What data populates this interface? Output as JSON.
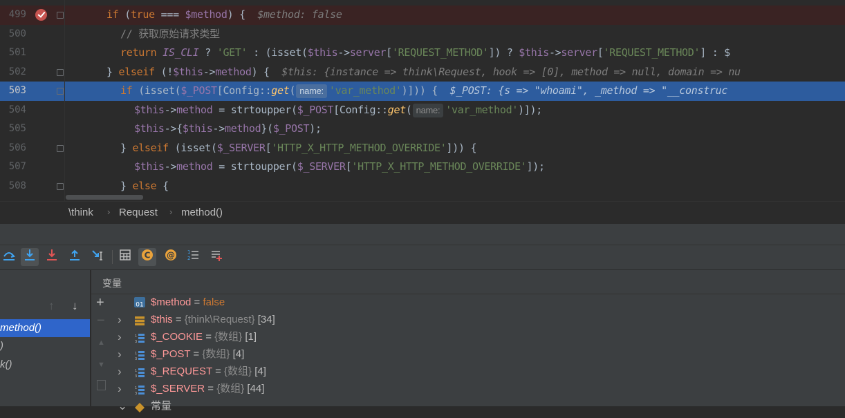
{
  "editor": {
    "lines": [
      {
        "num": "499",
        "tokens": [
          [
            "kw",
            "if"
          ],
          [
            "p",
            " ("
          ],
          [
            "kw",
            "true"
          ],
          [
            "p",
            " === "
          ],
          [
            "var",
            "$method"
          ],
          [
            "p",
            ") {"
          ]
        ],
        "hint": "$method: false",
        "indent": 3
      },
      {
        "num": "500",
        "tokens": [
          [
            "cmt",
            "// 获取原始请求类型"
          ]
        ],
        "indent": 4
      },
      {
        "num": "501",
        "tokens": [
          [
            "kw",
            "return "
          ],
          [
            "const",
            "IS_CLI"
          ],
          [
            "p",
            " ? "
          ],
          [
            "str",
            "'GET'"
          ],
          [
            "p",
            " : (isset("
          ],
          [
            "var",
            "$this"
          ],
          [
            "p",
            "->"
          ],
          [
            "var",
            "server"
          ],
          [
            "p",
            "["
          ],
          [
            "str",
            "'REQUEST_METHOD'"
          ],
          [
            "p",
            "]) ? "
          ],
          [
            "var",
            "$this"
          ],
          [
            "p",
            "->"
          ],
          [
            "var",
            "server"
          ],
          [
            "p",
            "["
          ],
          [
            "str",
            "'REQUEST_METHOD'"
          ],
          [
            "p",
            "] : $"
          ]
        ],
        "indent": 4
      },
      {
        "num": "502",
        "tokens": [
          [
            "p",
            "} "
          ],
          [
            "kw",
            "elseif"
          ],
          [
            "p",
            " (!"
          ],
          [
            "var",
            "$this"
          ],
          [
            "p",
            "->"
          ],
          [
            "var",
            "method"
          ],
          [
            "p",
            ") {"
          ]
        ],
        "hint": "$this: {instance => think\\Request, hook => [0], method => null, domain => nu",
        "indent": 3
      },
      {
        "num": "503",
        "tokens": [
          [
            "kw",
            "if"
          ],
          [
            "p",
            " (isset("
          ],
          [
            "var",
            "$_POST"
          ],
          [
            "p",
            "[Config::"
          ],
          [
            "fn",
            "get"
          ],
          [
            "p",
            "("
          ],
          [
            "pill",
            "name:"
          ],
          [
            "str",
            "'var_method'"
          ],
          [
            "p",
            ")])) {"
          ]
        ],
        "hint": "$_POST: {s => \"whoami\", _method => \"__construc",
        "indent": 4
      },
      {
        "num": "504",
        "tokens": [
          [
            "var",
            "$this"
          ],
          [
            "p",
            "->"
          ],
          [
            "var",
            "method"
          ],
          [
            "p",
            " = strtoupper("
          ],
          [
            "var",
            "$_POST"
          ],
          [
            "p",
            "[Config::"
          ],
          [
            "fn",
            "get"
          ],
          [
            "p",
            "("
          ],
          [
            "pill",
            "name:"
          ],
          [
            "str",
            "'var_method'"
          ],
          [
            "p",
            ")]);"
          ]
        ],
        "indent": 5
      },
      {
        "num": "505",
        "tokens": [
          [
            "var",
            "$this"
          ],
          [
            "p",
            "->{"
          ],
          [
            "var",
            "$this"
          ],
          [
            "p",
            "->"
          ],
          [
            "var",
            "method"
          ],
          [
            "p",
            "}("
          ],
          [
            "var",
            "$_POST"
          ],
          [
            "p",
            ");"
          ]
        ],
        "indent": 5
      },
      {
        "num": "506",
        "tokens": [
          [
            "p",
            "} "
          ],
          [
            "kw",
            "elseif"
          ],
          [
            "p",
            " (isset("
          ],
          [
            "var",
            "$_SERVER"
          ],
          [
            "p",
            "["
          ],
          [
            "str",
            "'HTTP_X_HTTP_METHOD_OVERRIDE'"
          ],
          [
            "p",
            "])) {"
          ]
        ],
        "indent": 4
      },
      {
        "num": "507",
        "tokens": [
          [
            "var",
            "$this"
          ],
          [
            "p",
            "->"
          ],
          [
            "var",
            "method"
          ],
          [
            "p",
            " = strtoupper("
          ],
          [
            "var",
            "$_SERVER"
          ],
          [
            "p",
            "["
          ],
          [
            "str",
            "'HTTP_X_HTTP_METHOD_OVERRIDE'"
          ],
          [
            "p",
            "]);"
          ]
        ],
        "indent": 5
      },
      {
        "num": "508",
        "tokens": [
          [
            "p",
            "} "
          ],
          [
            "kw",
            "else"
          ],
          [
            "p",
            " {"
          ]
        ],
        "indent": 4
      }
    ]
  },
  "breadcrumb": {
    "items": [
      "\\think",
      "Request",
      "method()"
    ]
  },
  "frames": {
    "items": [
      "method()",
      ")",
      "k()"
    ]
  },
  "variables": {
    "title": "变量",
    "rows": [
      {
        "name": "$method",
        "eq": " = ",
        "value": "false",
        "valueType": "kw",
        "type": "",
        "count": "",
        "expandable": false,
        "icon": "boolean-icon"
      },
      {
        "name": "$this",
        "eq": " = ",
        "value": "",
        "type": "{think\\Request}",
        "count": " [34]",
        "expandable": true,
        "icon": "object-icon"
      },
      {
        "name": "$_COOKIE",
        "eq": " = ",
        "value": "",
        "type": "{数组}",
        "count": " [1]",
        "expandable": true,
        "icon": "array-icon"
      },
      {
        "name": "$_POST",
        "eq": " = ",
        "value": "",
        "type": "{数组}",
        "count": " [4]",
        "expandable": true,
        "icon": "array-icon"
      },
      {
        "name": "$_REQUEST",
        "eq": " = ",
        "value": "",
        "type": "{数组}",
        "count": " [4]",
        "expandable": true,
        "icon": "array-icon"
      },
      {
        "name": "$_SERVER",
        "eq": " = ",
        "value": "",
        "type": "{数组}",
        "count": " [44]",
        "expandable": true,
        "icon": "array-icon"
      },
      {
        "name": "常量",
        "eq": "",
        "value": "",
        "type": "",
        "count": "",
        "expandable": true,
        "icon": "constants-icon"
      }
    ]
  }
}
